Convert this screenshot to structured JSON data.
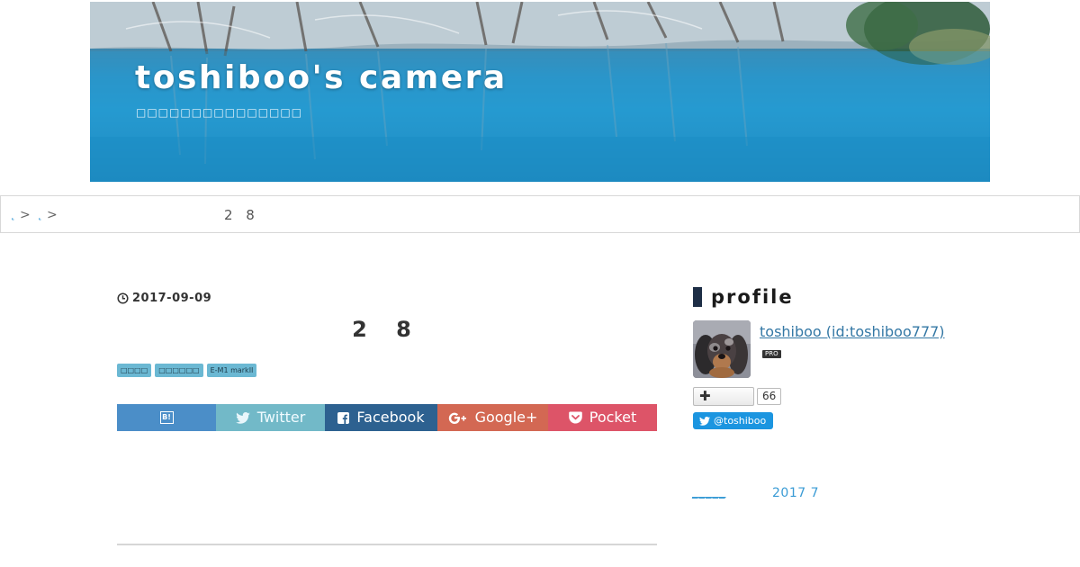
{
  "header": {
    "title": "toshiboo's camera",
    "subtitle": "□□□□□□□□□□□□□□□"
  },
  "breadcrumb": {
    "items": [
      "˛",
      "˛"
    ],
    "separator": ">",
    "current": "2 8"
  },
  "entry": {
    "date": "2017-09-09",
    "title": "2 8",
    "categories": [
      "□□□□",
      "□□□□□□",
      "E-M1 markII"
    ]
  },
  "share": {
    "hatena_label": "B!",
    "twitter_label": "Twitter",
    "facebook_label": "Facebook",
    "google_label": "Google+",
    "pocket_label": "Pocket"
  },
  "sidebar": {
    "heading": "profile",
    "profile_name": "toshiboo (id:toshiboo777)",
    "pro_badge": "PRO",
    "follow_count": "66",
    "twitter_handle": "@toshiboo",
    "archive_link": "_____",
    "archive_month": "2017  7"
  },
  "colors": {
    "hatena": "#4b8ec8",
    "twitter": "#72b9c8",
    "facebook": "#2d6190",
    "google": "#d36853",
    "pocket": "#dd5468",
    "link": "#3a9bd5",
    "category_tag": "#6bb8d3",
    "heading_bar": "#1e2e46"
  }
}
